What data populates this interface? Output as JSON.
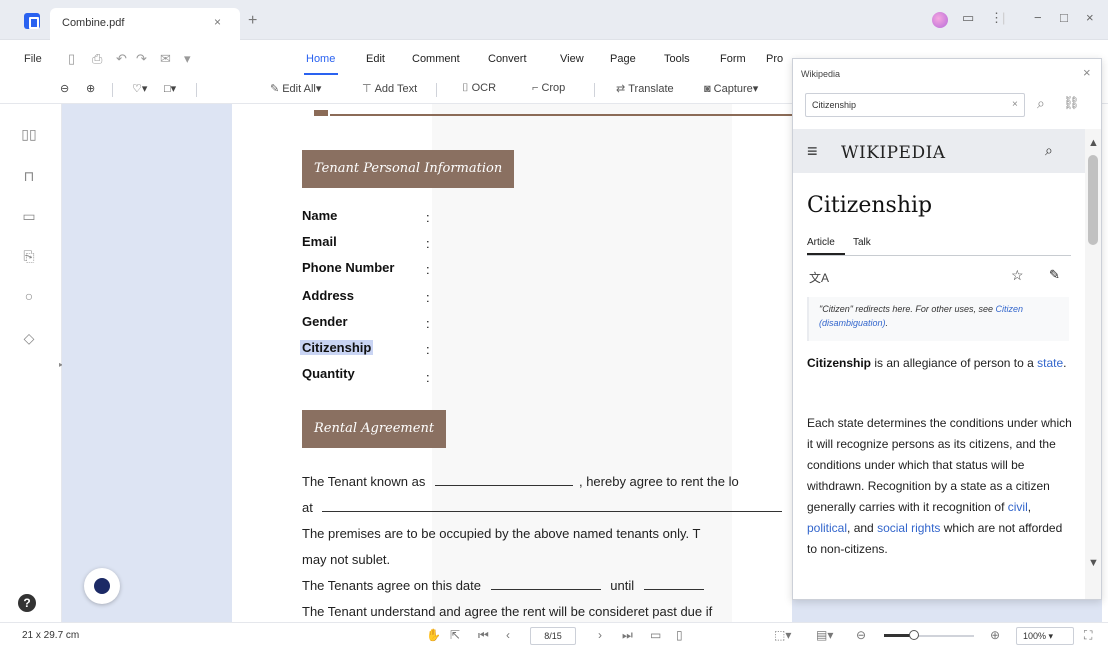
{
  "window": {
    "tab_title": "Combine.pdf",
    "tab_close": "×",
    "tab_add": "+",
    "min": "−",
    "max": "□",
    "close": "×"
  },
  "menubar": {
    "file": "File",
    "items": [
      "Home",
      "Edit",
      "Comment",
      "Convert",
      "View",
      "Page",
      "Tools",
      "Form",
      "Pro"
    ]
  },
  "toolbar": {
    "edit_all": "Edit All",
    "add_text": "Add Text",
    "ocr": "OCR",
    "crop": "Crop",
    "translate": "Translate",
    "capture": "Capture"
  },
  "document": {
    "section1": "Tenant Personal Information",
    "fields": [
      "Name",
      "Email",
      "Phone Number",
      "Address",
      "Gender",
      "Citizenship",
      "Quantity"
    ],
    "colon": ":",
    "section2": "Rental Agreement",
    "lines": {
      "l1a": "The Tenant known as",
      "l1b": ", hereby agree to rent the lo",
      "l2": "at",
      "l3": "The premises are to be occupied by the above named tenants only. T",
      "l4": "may not sublet.",
      "l5a": "The Tenants agree on this date",
      "l5b": "until",
      "l6": "The Tenant understand and agree the rent will be consideret past due if"
    }
  },
  "wiki": {
    "panel_title": "Wikipedia",
    "search_value": "Citizenship",
    "logo": "WIKIPEDIA",
    "heading": "Citizenship",
    "tab_article": "Article",
    "tab_talk": "Talk",
    "hatnote_pre": "\"Citizen\" redirects here. For other uses, see ",
    "hatnote_link": "Citizen (disambiguation)",
    "hatnote_post": ".",
    "p1_bold": "Citizenship",
    "p1_text": " is an allegiance of person to a ",
    "p1_link": "state",
    "p1_end": ".",
    "p2_a": "Each state determines the conditions under which it will recognize persons as its citizens, and the conditions under which that status will be withdrawn. Recognition by a state as a citizen generally carries with it recognition of ",
    "p2_l1": "civil",
    "p2_sep1": ", ",
    "p2_l2": "political",
    "p2_sep2": ", and ",
    "p2_l3": "social rights",
    "p2_b": " which are not afforded to non-citizens."
  },
  "status": {
    "dimensions": "21 x 29.7 cm",
    "page": "8/15",
    "zoom": "100%",
    "zoom_level": 0.33
  },
  "icons": {
    "search": "⌕",
    "star": "☆",
    "pencil": "✎",
    "lang": "文A",
    "hamburger": "≡"
  }
}
